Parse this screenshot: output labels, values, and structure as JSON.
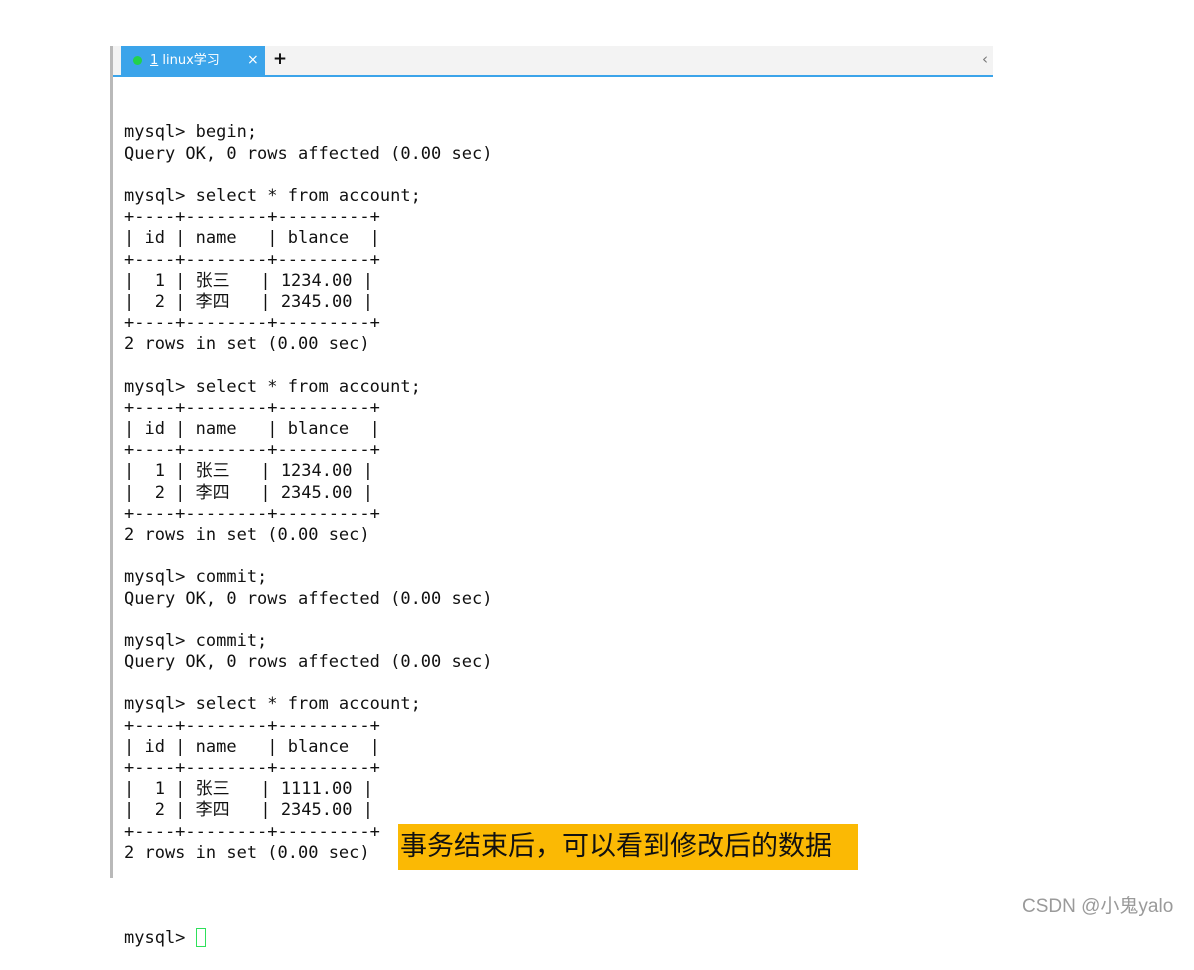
{
  "tab": {
    "number": "1",
    "title": " linux学习",
    "close": "×",
    "new_tab": "+",
    "scroll": "‹",
    "status_color": "#22d24b",
    "accent_color": "#3ba4ea"
  },
  "terminal_lines": [
    "mysql> begin;",
    "Query OK, 0 rows affected (0.00 sec)",
    "",
    "mysql> select * from account;",
    "+----+--------+---------+",
    "| id | name   | blance  |",
    "+----+--------+---------+",
    "|  1 | 张三   | 1234.00 |",
    "|  2 | 李四   | 2345.00 |",
    "+----+--------+---------+",
    "2 rows in set (0.00 sec)",
    "",
    "mysql> select * from account;",
    "+----+--------+---------+",
    "| id | name   | blance  |",
    "+----+--------+---------+",
    "|  1 | 张三   | 1234.00 |",
    "|  2 | 李四   | 2345.00 |",
    "+----+--------+---------+",
    "2 rows in set (0.00 sec)",
    "",
    "mysql> commit;",
    "Query OK, 0 rows affected (0.00 sec)",
    "",
    "mysql> commit;",
    "Query OK, 0 rows affected (0.00 sec)",
    "",
    "mysql> select * from account;",
    "+----+--------+---------+",
    "| id | name   | blance  |",
    "+----+--------+---------+",
    "|  1 | 张三   | 1111.00 |",
    "|  2 | 李四   | 2345.00 |",
    "+----+--------+---------+",
    "2 rows in set (0.00 sec)",
    ""
  ],
  "prompt": "mysql> ",
  "annotation": "事务结束后，可以看到修改后的数据",
  "watermark": "CSDN @小鬼yalo",
  "colors": {
    "annotation_bg": "#fbb904",
    "cursor": "#2ee05a"
  }
}
